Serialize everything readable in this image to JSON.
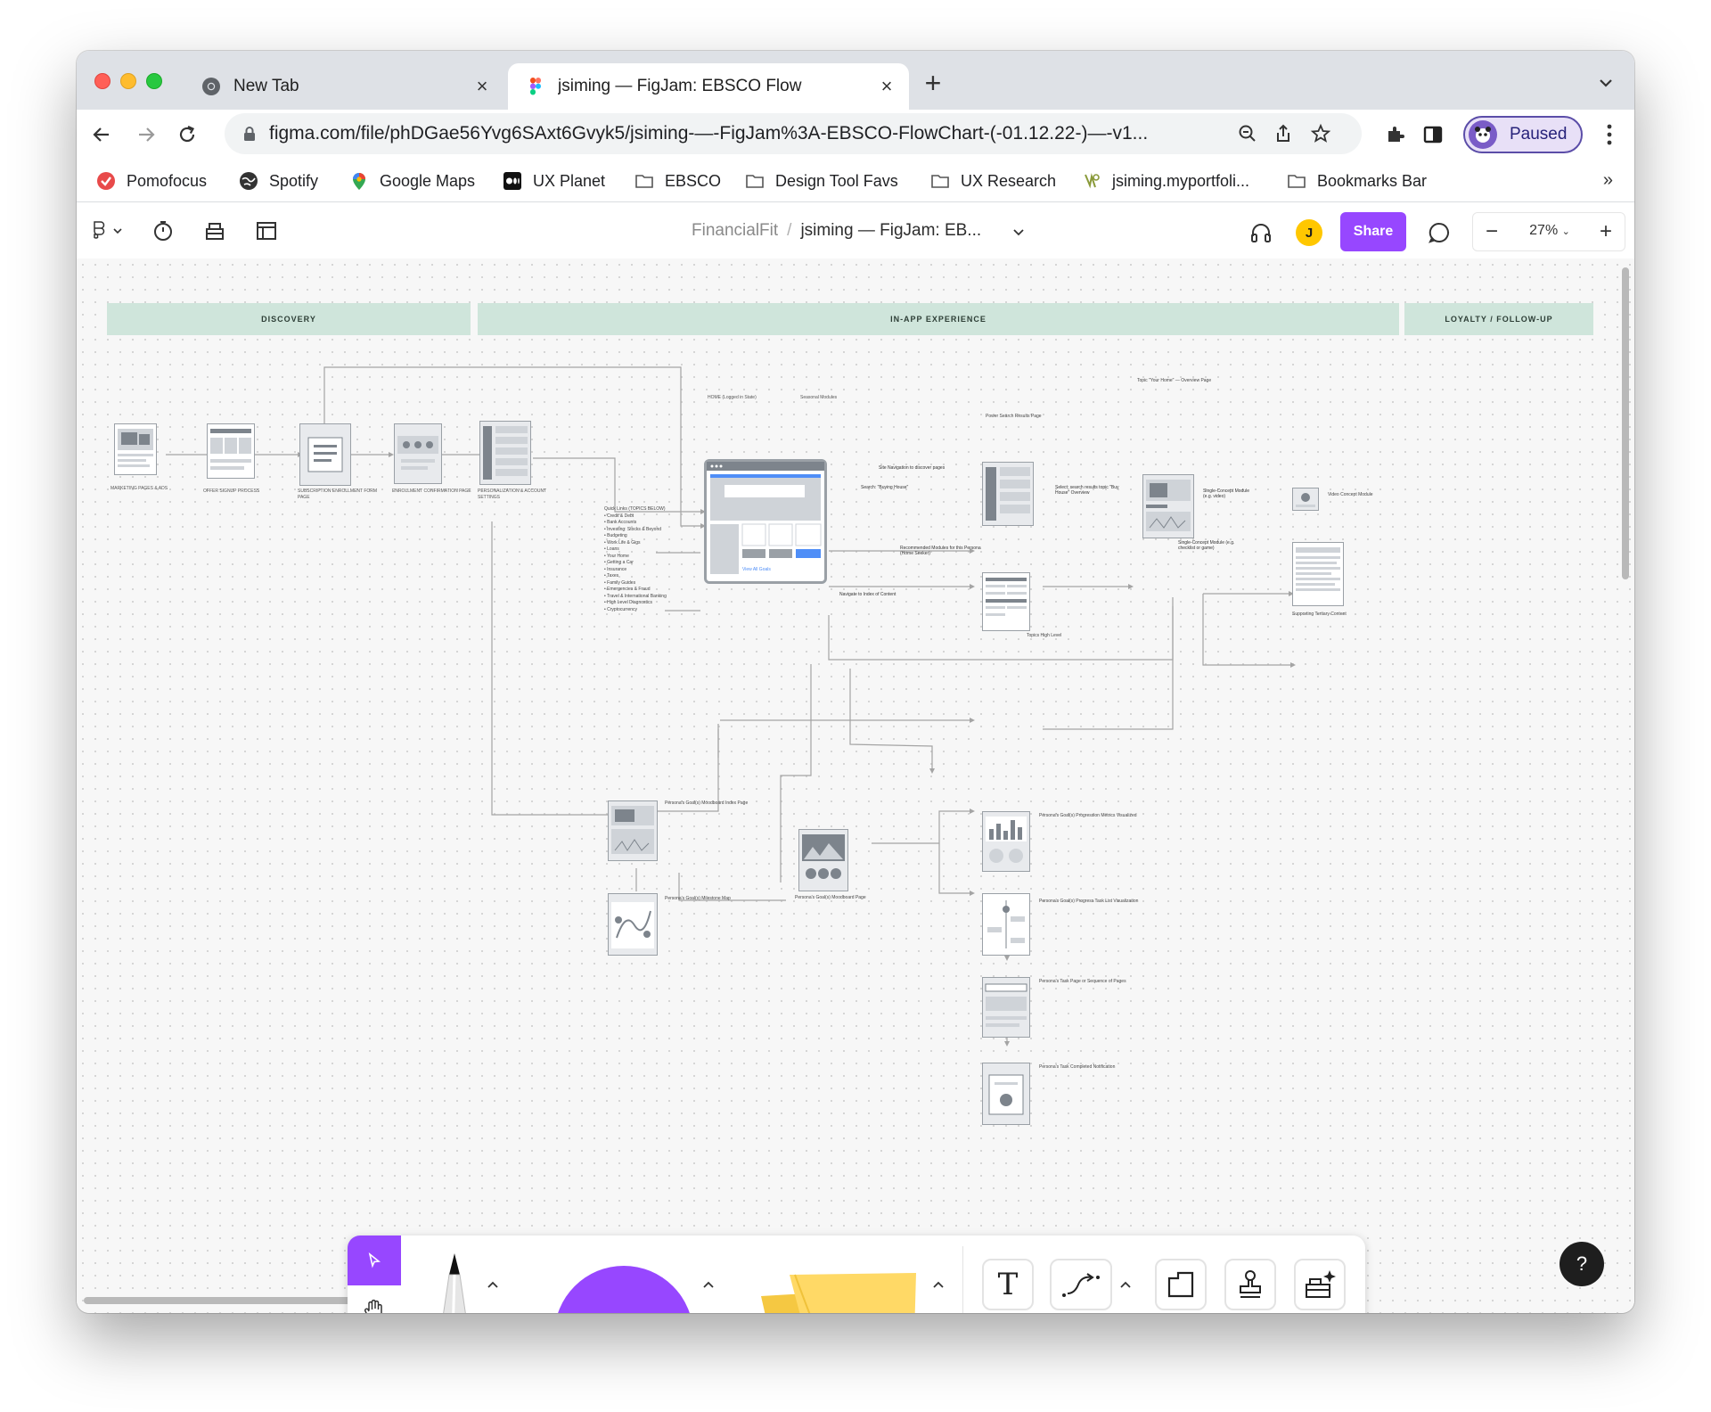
{
  "browser": {
    "tabs": [
      {
        "label": "New Tab"
      },
      {
        "label": "jsiming — FigJam: EBSCO Flow"
      }
    ],
    "url": "figma.com/file/phDGae56Yvg6SAxt6Gvyk5/jsiming-—-FigJam%3A-EBSCO-FlowChart-(-01.12.22-)—-v1...",
    "profile_status": "Paused",
    "bookmarks": [
      {
        "label": "Pomofocus",
        "icon": "pomofocus-icon"
      },
      {
        "label": "Spotify",
        "icon": "globe-icon"
      },
      {
        "label": "Google Maps",
        "icon": "maps-pin-icon"
      },
      {
        "label": "UX Planet",
        "icon": "medium-icon"
      },
      {
        "label": "EBSCO",
        "icon": "folder-icon"
      },
      {
        "label": "Design Tool Favs",
        "icon": "folder-icon"
      },
      {
        "label": "UX Research",
        "icon": "folder-icon"
      },
      {
        "label": "jsiming.myportfoli...",
        "icon": "portfolio-icon"
      },
      {
        "label": "Bookmarks Bar",
        "icon": "folder-icon"
      }
    ],
    "more_bookmarks": "»"
  },
  "figma": {
    "breadcrumb_project": "FinancialFit",
    "breadcrumb_sep": "/",
    "file_name": "jsiming — FigJam: EB...",
    "user_initial": "J",
    "share_label": "Share",
    "zoom": "27%",
    "zoom_out": "−",
    "zoom_in": "+",
    "help": "?"
  },
  "board": {
    "stages": [
      "DISCOVERY",
      "IN-APP EXPERIENCE",
      "LOYALTY / FOLLOW-UP"
    ],
    "labels": {
      "marketing": "MARKETING PAGES & ADS",
      "offer": "OFFER SIGNUP PROCESS",
      "subscription": "SUBSCRIPTION ENROLLMENT FORM PAGE",
      "enrollment": "ENROLLMENT CONFIRMATION PAGE",
      "personalization": "PERSONALIZATION & ACCOUNT SETTINGS",
      "home": "HOME (Logged in State)",
      "seasonal": "Seasonal Modules",
      "quick_links": "Quick Links (TOPICS BELOW)",
      "view_all_goals": "View All Goals",
      "site_nav": "Site Navigation to discover pages",
      "search": "Search: \"Buying House\"",
      "search_results": "Select: search results topic \"Buy House\" Overview",
      "powerful_search": "Power Search Results Page",
      "topic_home": "Topic \"Your Home\" — Overview Page",
      "single_concept_video": "Single-Concept Module (e.g. video)",
      "video_concept": "Video Concept Module",
      "single_concept_check": "Single-Concept Module (e.g. checklist or game)",
      "recommended": "Recommended Modules for this Persona (Home Seeker)",
      "navigate_index": "Navigate to Index of Content",
      "topics_level": "Topics High Level",
      "supporting_tertiary": "Supporting Tertiary Content",
      "moodboard_index": "Persona's Goal(s) Moodboard Index Page",
      "moodboard_page": "Persona's Goal(s) Moodboard Page",
      "milestone_map": "Persona's Goal(s) Milestone Map",
      "progression": "Persona's Goal(s) Progression Metrics Visualized",
      "progress_task": "Persona's Goal(s) Progress Task List Visualization",
      "task_page": "Persona's Task Page or Sequence of Pages",
      "task_completed": "Persona's Task Completed Notification"
    },
    "quick_links": [
      "Credit & Debt",
      "Bank Accounts",
      "Investing: Stocks & Beyond",
      "Budgeting",
      "Work Life & Gigs",
      "Loans",
      "Your Home",
      "Getting a Car",
      "Insurance",
      "Taxes",
      "Family Guides",
      "Emergencies & Fraud",
      "Travel & International Banking",
      "High Level Diagnostics",
      "Cryptocurrency"
    ]
  },
  "toolbar_tools": [
    {
      "name": "select-tool"
    },
    {
      "name": "hand-tool"
    },
    {
      "name": "marker-tool"
    },
    {
      "name": "shape-tool"
    },
    {
      "name": "sticky-tool"
    },
    {
      "name": "text-tool",
      "label": "T"
    },
    {
      "name": "connector-tool"
    },
    {
      "name": "section-tool"
    },
    {
      "name": "stamp-tool"
    },
    {
      "name": "widgets-tool"
    }
  ],
  "colors": {
    "figma_purple": "#9747ff",
    "stage_band": "#cfe5db",
    "sticky": "#ffd966",
    "avatar": "#ffc700"
  }
}
